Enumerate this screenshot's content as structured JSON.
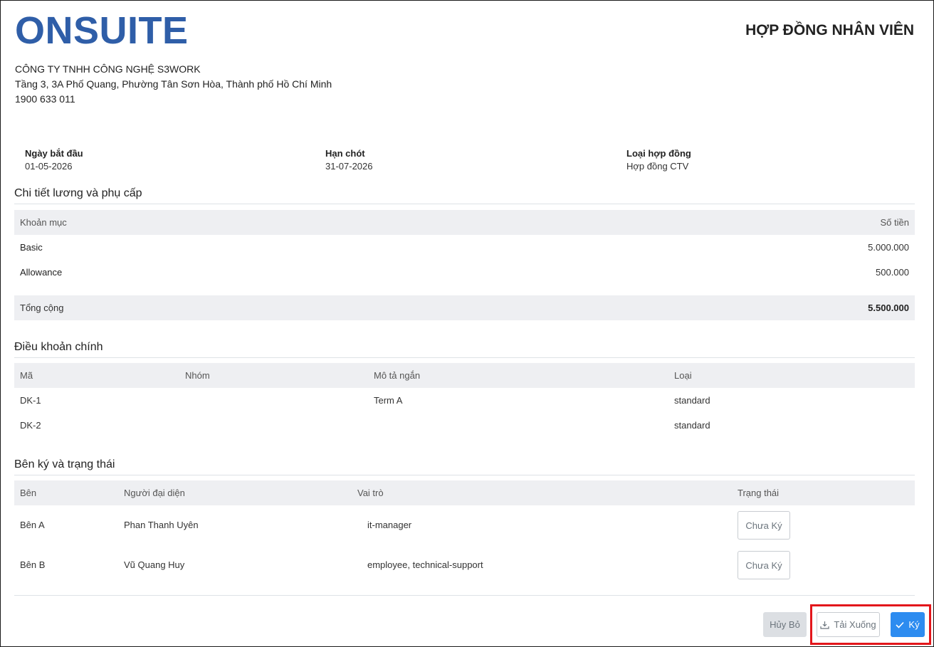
{
  "header": {
    "logo_text": "ONSUITE",
    "doc_title": "HỢP ĐỒNG NHÂN VIÊN"
  },
  "company": {
    "name": "CÔNG TY TNHH CÔNG NGHỆ S3WORK",
    "address": "Tầng 3, 3A Phố Quang, Phường Tân Sơn Hòa, Thành phố Hồ Chí Minh",
    "phone": "1900 633 011"
  },
  "meta": {
    "start_label": "Ngày bắt đầu",
    "start_value": "01-05-2026",
    "deadline_label": "Hạn chót",
    "deadline_value": "31-07-2026",
    "type_label": "Loại hợp đồng",
    "type_value": "Hợp đồng CTV"
  },
  "salary": {
    "title": "Chi tiết lương và phụ cấp",
    "col_item": "Khoản mục",
    "col_amount": "Số tiền",
    "rows": [
      {
        "item": "Basic",
        "amount": "5.000.000"
      },
      {
        "item": "Allowance",
        "amount": "500.000"
      }
    ],
    "total_label": "Tổng cộng",
    "total_value": "5.500.000"
  },
  "terms": {
    "title": "Điều khoản chính",
    "col_code": "Mã",
    "col_group": "Nhóm",
    "col_desc": "Mô tả ngắn",
    "col_type": "Loại",
    "rows": [
      {
        "code": "DK-1",
        "group": "",
        "desc": "Term A",
        "type": "standard"
      },
      {
        "code": "DK-2",
        "group": "",
        "desc": "",
        "type": "standard"
      }
    ]
  },
  "signers": {
    "title": "Bên ký và trạng thái",
    "col_party": "Bên",
    "col_rep": "Người đại diện",
    "col_role": "Vai trò",
    "col_status": "Trạng thái",
    "rows": [
      {
        "party": "Bên A",
        "rep": "Phan Thanh Uyên",
        "role": "it-manager",
        "status": "Chưa Ký"
      },
      {
        "party": "Bên B",
        "rep": "Vũ Quang Huy",
        "role": "employee, technical-support",
        "status": "Chưa Ký"
      }
    ]
  },
  "actions": {
    "cancel_label": "Hủy Bỏ",
    "download_label": "Tải Xuống",
    "sign_label": "Ký"
  },
  "colors": {
    "logo": "#2f5ea8",
    "primary": "#2d8cf0",
    "highlight": "#e3161b"
  },
  "icons": {
    "download": "download-icon",
    "sign": "check-icon"
  }
}
